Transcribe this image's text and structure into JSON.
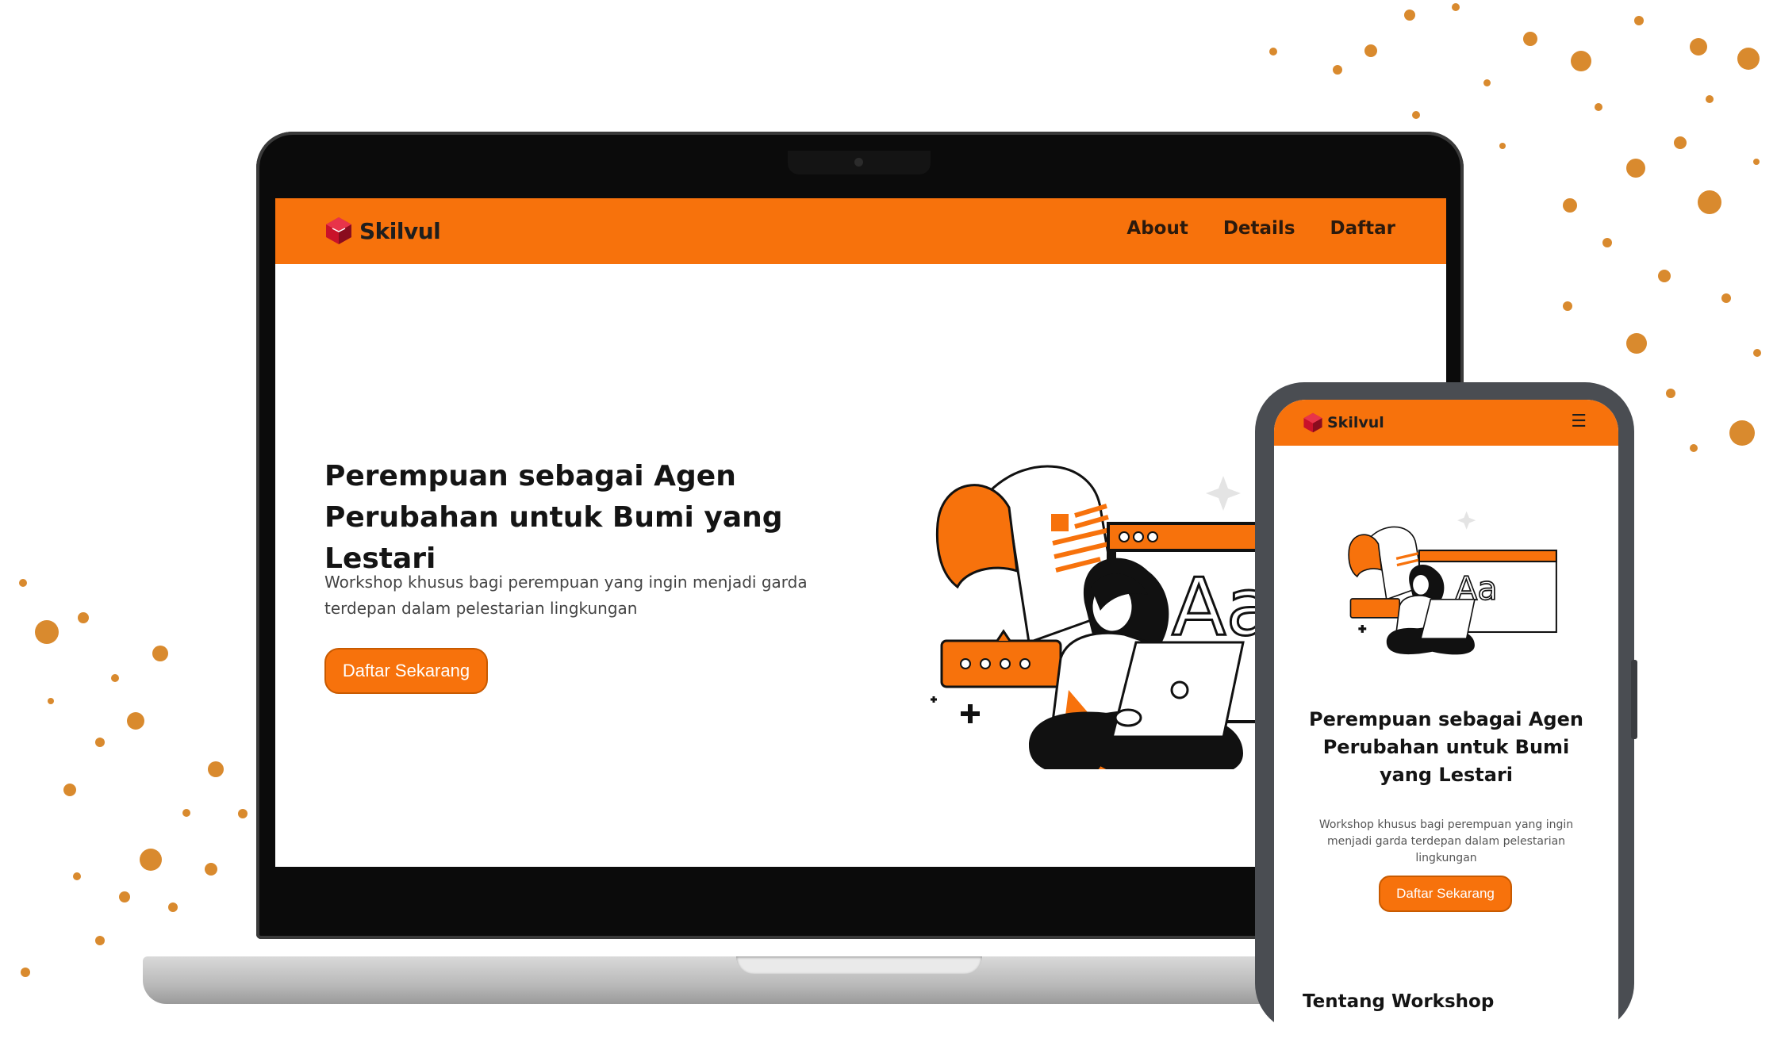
{
  "colors": {
    "accent": "#f7720c",
    "splatter": "#d98a2e",
    "text": "#141414"
  },
  "laptop": {
    "brand": {
      "name": "Skilvul",
      "icon": "skilvul-logo-icon"
    },
    "nav": [
      {
        "label": "About"
      },
      {
        "label": "Details"
      },
      {
        "label": "Daftar"
      }
    ],
    "hero": {
      "title": "Perempuan sebagai Agen Perubahan untuk Bumi yang Lestari",
      "subtitle": "Workshop khusus bagi perempuan yang ingin menjadi garda terdepan dalam pelestarian lingkungan",
      "cta": "Daftar Sekarang",
      "illustration_text": "Aa"
    }
  },
  "phone": {
    "brand": {
      "name": "Skilvul",
      "icon": "skilvul-logo-icon"
    },
    "menu_icon": "hamburger-menu-icon",
    "menu_glyph": "☰",
    "hero": {
      "title": "Perempuan sebagai Agen Perubahan untuk Bumi yang Lestari",
      "subtitle": "Workshop khusus bagi perempuan yang ingin menjadi garda terdepan dalam pelestarian lingkungan",
      "cta": "Daftar Sekarang",
      "illustration_text": "Aa"
    },
    "section_heading": "Tentang Workshop"
  }
}
